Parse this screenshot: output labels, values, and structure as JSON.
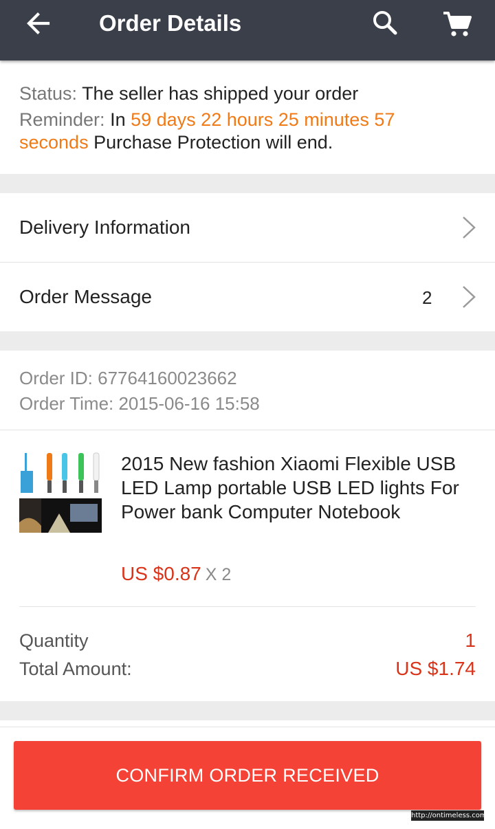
{
  "header": {
    "title": "Order Details",
    "icons": [
      "back-arrow-icon",
      "search-icon",
      "cart-icon"
    ]
  },
  "status": {
    "status_label": "Status:",
    "status_text": "The seller has shipped your order",
    "reminder_label": "Reminder:",
    "reminder_prefix": "In",
    "countdown_line1": "59 days 22 hours 25 minutes 57",
    "countdown_line2": "seconds",
    "reminder_suffix": "Purchase Protection will end."
  },
  "rows": {
    "delivery_label": "Delivery Information",
    "message_label": "Order Message",
    "message_count": "2"
  },
  "order": {
    "id_text": "Order ID: 67764160023662",
    "time_text": "Order Time: 2015-06-16 15:58"
  },
  "product": {
    "name": "2015 New fashion Xiaomi Flexible USB LED Lamp portable USB LED lights For Power bank Computer Notebook",
    "price": "US $0.87",
    "times": "X 2"
  },
  "summary": {
    "quantity_label": "Quantity",
    "quantity_value": "1",
    "total_label": "Total Amount:",
    "total_value": "US $1.74"
  },
  "actions": {
    "confirm_label": "CONFIRM ORDER RECEIVED"
  },
  "watermark": "http://ontimeless.com",
  "colors": {
    "header_bg": "#3b3f4a",
    "accent_orange": "#f07a16",
    "price_red": "#d9341a",
    "button_red": "#f44336"
  }
}
